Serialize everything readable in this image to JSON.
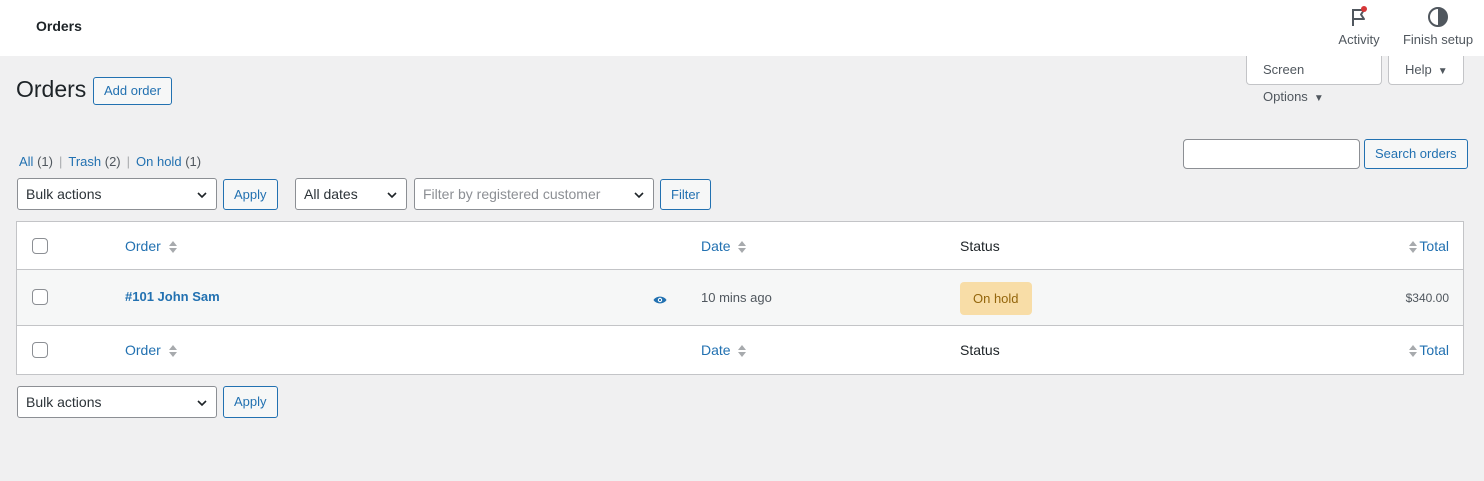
{
  "header": {
    "title": "Orders",
    "activity_label": "Activity",
    "finish_setup_label": "Finish setup"
  },
  "screen_options": {
    "label": "Screen Options",
    "help_label": "Help"
  },
  "page": {
    "title": "Orders",
    "add_order_label": "Add order"
  },
  "views": [
    {
      "label": "All",
      "count": "(1)"
    },
    {
      "label": "Trash",
      "count": "(2)"
    },
    {
      "label": "On hold",
      "count": "(1)"
    }
  ],
  "search": {
    "button_label": "Search orders",
    "value": ""
  },
  "filters": {
    "bulk_actions": "Bulk actions",
    "apply_label": "Apply",
    "dates": "All dates",
    "customer_placeholder": "Filter by registered customer",
    "filter_label": "Filter"
  },
  "table": {
    "columns": {
      "order": "Order",
      "date": "Date",
      "status": "Status",
      "total": "Total"
    },
    "rows": [
      {
        "order": "#101 John Sam",
        "date": "10 mins ago",
        "status": "On hold",
        "total": "$340.00"
      }
    ]
  },
  "colors": {
    "accent": "#2271b1",
    "on_hold_bg": "#f8dda7",
    "on_hold_text": "#94660c",
    "notification_dot": "#d63638"
  }
}
